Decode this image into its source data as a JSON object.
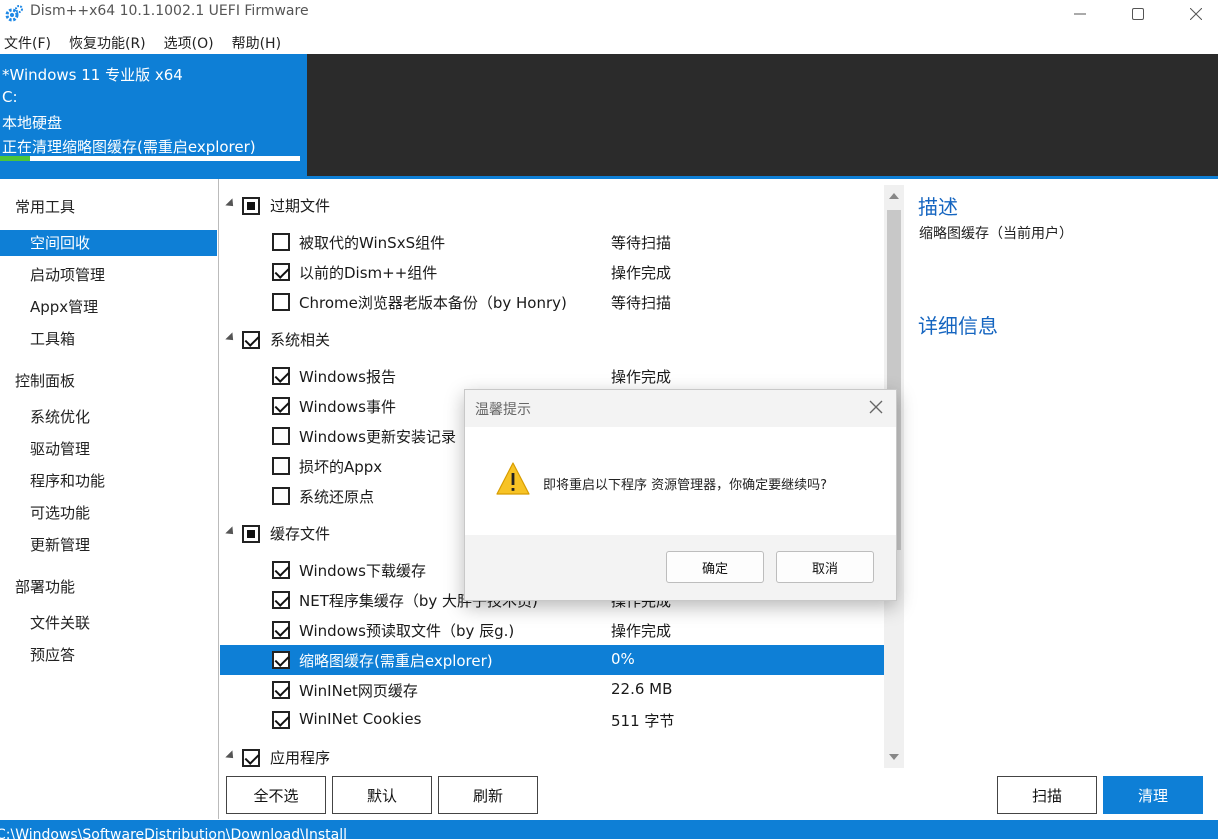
{
  "window": {
    "title": "Dism++x64 10.1.1002.1 UEFI Firmware"
  },
  "menu": [
    "文件(F)",
    "恢复功能(R)",
    "选项(O)",
    "帮助(H)"
  ],
  "header": {
    "os": "*Windows 11 专业版 x64",
    "drive": "C:",
    "disk": "本地硬盘",
    "status": "正在清理缩略图缓存(需重启explorer)",
    "progress": 0.1
  },
  "sidebar": {
    "categories": [
      {
        "label": "常用工具",
        "items": [
          "空间回收",
          "启动项管理",
          "Appx管理",
          "工具箱"
        ]
      },
      {
        "label": "控制面板",
        "items": [
          "系统优化",
          "驱动管理",
          "程序和功能",
          "可选功能",
          "更新管理"
        ]
      },
      {
        "label": "部署功能",
        "items": [
          "文件关联",
          "预应答"
        ]
      }
    ],
    "active": "空间回收"
  },
  "groups": [
    {
      "label": "过期文件",
      "state": "partial",
      "items": [
        {
          "label": "被取代的WinSxS组件",
          "status": "等待扫描",
          "checked": false
        },
        {
          "label": "以前的Dism++组件",
          "status": "操作完成",
          "checked": true
        },
        {
          "label": "Chrome浏览器老版本备份（by Honry)",
          "status": "等待扫描",
          "checked": false
        }
      ]
    },
    {
      "label": "系统相关",
      "state": "checked",
      "items": [
        {
          "label": "Windows报告",
          "status": "操作完成",
          "checked": true
        },
        {
          "label": "Windows事件",
          "status": "",
          "checked": true
        },
        {
          "label": "Windows更新安装记录",
          "status": "",
          "checked": false
        },
        {
          "label": "损坏的Appx",
          "status": "",
          "checked": false
        },
        {
          "label": "系统还原点",
          "status": "",
          "checked": false
        }
      ]
    },
    {
      "label": "缓存文件",
      "state": "partial",
      "items": [
        {
          "label": "Windows下载缓存",
          "status": "",
          "checked": true
        },
        {
          "label": "NET程序集缓存（by 大胖子技术员)",
          "status": "操作完成",
          "checked": true
        },
        {
          "label": "Windows预读取文件（by 辰g.)",
          "status": "操作完成",
          "checked": true
        },
        {
          "label": "缩略图缓存(需重启explorer)",
          "status": "0%",
          "checked": true,
          "selected": true
        },
        {
          "label": "WinINet网页缓存",
          "status": "22.6 MB",
          "checked": true
        },
        {
          "label": "WinINet Cookies",
          "status": "511 字节",
          "checked": true
        }
      ]
    },
    {
      "label": "应用程序",
      "state": "checked",
      "items": []
    }
  ],
  "description": {
    "heading": "描述",
    "text": "缩略图缓存（当前用户）",
    "details_heading": "详细信息"
  },
  "buttons": {
    "select_none": "全不选",
    "default": "默认",
    "refresh": "刷新",
    "scan": "扫描",
    "clean": "清理"
  },
  "statusbar": {
    "path": "C:\\Windows\\SoftwareDistribution\\Download\\Install"
  },
  "dialog": {
    "title": "温馨提示",
    "message": "即将重启以下程序 资源管理器，你确定要继续吗?",
    "ok": "确定",
    "cancel": "取消"
  },
  "colors": {
    "accent": "#0e7fd6",
    "progress": "#4cc53a",
    "header_dark": "#2b2b2b",
    "link": "#1565c0"
  }
}
